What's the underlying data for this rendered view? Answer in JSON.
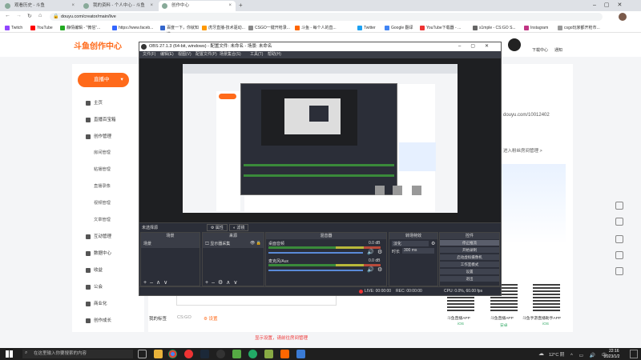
{
  "browser": {
    "tabs": [
      {
        "label": "观看历史 - 斗鱼",
        "active": false
      },
      {
        "label": "我的资料 - 个人中心 - 斗鱼",
        "active": false
      },
      {
        "label": "创作中心",
        "active": true
      },
      {
        "label": "",
        "active": false
      }
    ],
    "url": "douyu.com/creator/main/live",
    "bookmarks": [
      "Twitch",
      "YouTube",
      "静情编辑 - \"微信\"...",
      "https://www.faceb...",
      "百度一下，你就知道",
      "虎牙直播-技术驱动...",
      "CSGO一键开枪录...",
      "斗鱼 - 每个人的直...",
      "Twitter",
      "Google 翻译",
      "YouTube下载器 - ...",
      "s1mple - CS:GO S...",
      "Instagram",
      "csgo玩家都开枪市..."
    ]
  },
  "site": {
    "logo_text": "斗鱼创作中心",
    "header_right": [
      "下载中心",
      "通知"
    ]
  },
  "sidebar": {
    "live_button": "直播中",
    "items": [
      {
        "label": "主页"
      },
      {
        "label": "直播百宝箱"
      },
      {
        "label": "创作管理"
      }
    ],
    "sub_items": [
      "房间管理",
      "粘播管理",
      "直播录像",
      "视频管理",
      "文章管理"
    ],
    "lower_items": [
      "互动管理",
      "数据中心",
      "收益",
      "公会",
      "商业化",
      "创作成长"
    ]
  },
  "main": {
    "my_tags_label": "我的标签",
    "tag_value": "CS:GO",
    "settings_link": "⚙ 设置",
    "footer_link": "显示设置，请前往房间管理",
    "right_panel": {
      "room_url": "douyu.com/10012402",
      "manage_link": "进入粉丝房间管理 >",
      "qr_labels": [
        "斗鱼直播APP",
        "斗鱼直播APP",
        "斗鱼手游直播助手APP"
      ],
      "qr_sublabels": [
        "iOS",
        "安卓",
        "iOS"
      ]
    }
  },
  "obs": {
    "title": "OBS 27.1.3 (64-bit, windows) - 配置文件: 未命名 - 场景: 未命名",
    "menu": [
      "文件(F)",
      "编辑(E)",
      "视图(V)",
      "配置文件(P)",
      "场景集合(S)",
      "工具(T)",
      "帮助(H)"
    ],
    "source_toolbar": "未选择源",
    "source_props": "属性",
    "source_filter": "滤镜",
    "panels": {
      "scenes": "场景",
      "sources": "来源",
      "mixer": "混音器",
      "transitions": "转场特效",
      "controls": "控件"
    },
    "scene_item": "场景",
    "source_item": "显示器采集",
    "mixer_channels": [
      {
        "name": "桌面音频",
        "db": "0.0 dB"
      },
      {
        "name": "麦克风/Aux",
        "db": "0.0 dB"
      }
    ],
    "transition": {
      "type": "淡化",
      "duration_label": "时长",
      "duration": "300 ms"
    },
    "controls": [
      "停止推流",
      "开始录制",
      "启动虚拟摄像机",
      "工作室模式",
      "设置",
      "退出"
    ],
    "status": {
      "live": "LIVE: 00:00:00",
      "rec": "REC: 00:00:00",
      "cpu": "CPU: 0.0%, 60.00 fps"
    }
  },
  "taskbar": {
    "search_placeholder": "在这里输入你要搜索的内容",
    "weather": "12°C 阴",
    "time": "22:16",
    "date": "2023/1/2"
  },
  "colors": {
    "accent": "#ff6a1a",
    "obs_bg": "#2b2e38",
    "taskbar": "#1f1f1f"
  }
}
